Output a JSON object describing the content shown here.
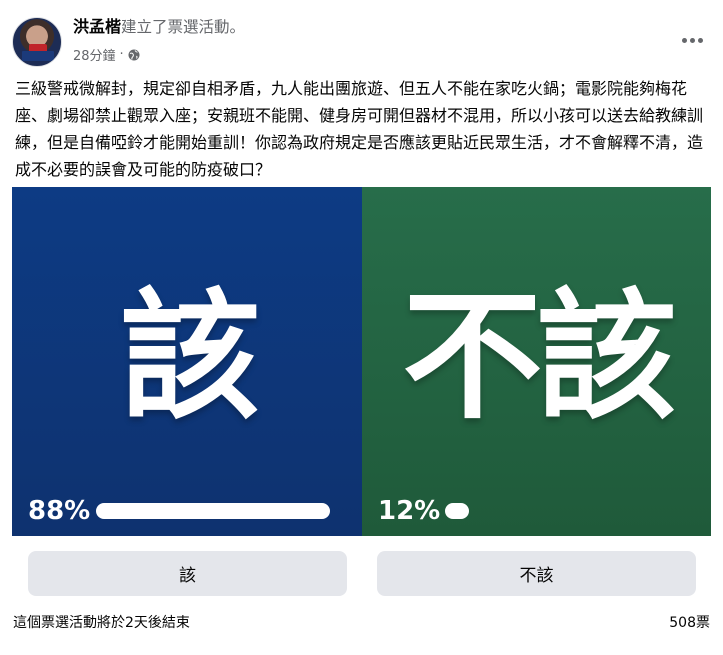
{
  "post": {
    "author": "洪孟楷",
    "action": "建立了票選活動。",
    "time": "28分鐘",
    "separator": "·",
    "privacy_icon": "globe-icon",
    "more_icon": "more-dots-icon",
    "text": "三級警戒微解封，規定卻自相矛盾，九人能出團旅遊、但五人不能在家吃火鍋；電影院能夠梅花座、劇場卻禁止觀眾入座；安親班不能開、健身房可開但器材不混用，所以小孩可以送去給教練訓練，但是自備啞鈴才能開始重訓！你認為政府規定是否應該更貼近民眾生活，才不會解釋不清，造成不必要的誤會及可能的防疫破口？"
  },
  "poll": {
    "options": [
      {
        "big_label": "該",
        "percent_text": "88%",
        "percent": 88,
        "button_label": "該",
        "color": "#0d3b84"
      },
      {
        "big_label": "不該",
        "percent_text": "12%",
        "percent": 12,
        "button_label": "不該",
        "color": "#276d4a"
      }
    ],
    "ends_text": "這個票選活動將於2天後結束",
    "votes_text": "508票"
  },
  "colors": {
    "button_bg": "#e4e6eb",
    "secondary_text": "#65676b"
  }
}
